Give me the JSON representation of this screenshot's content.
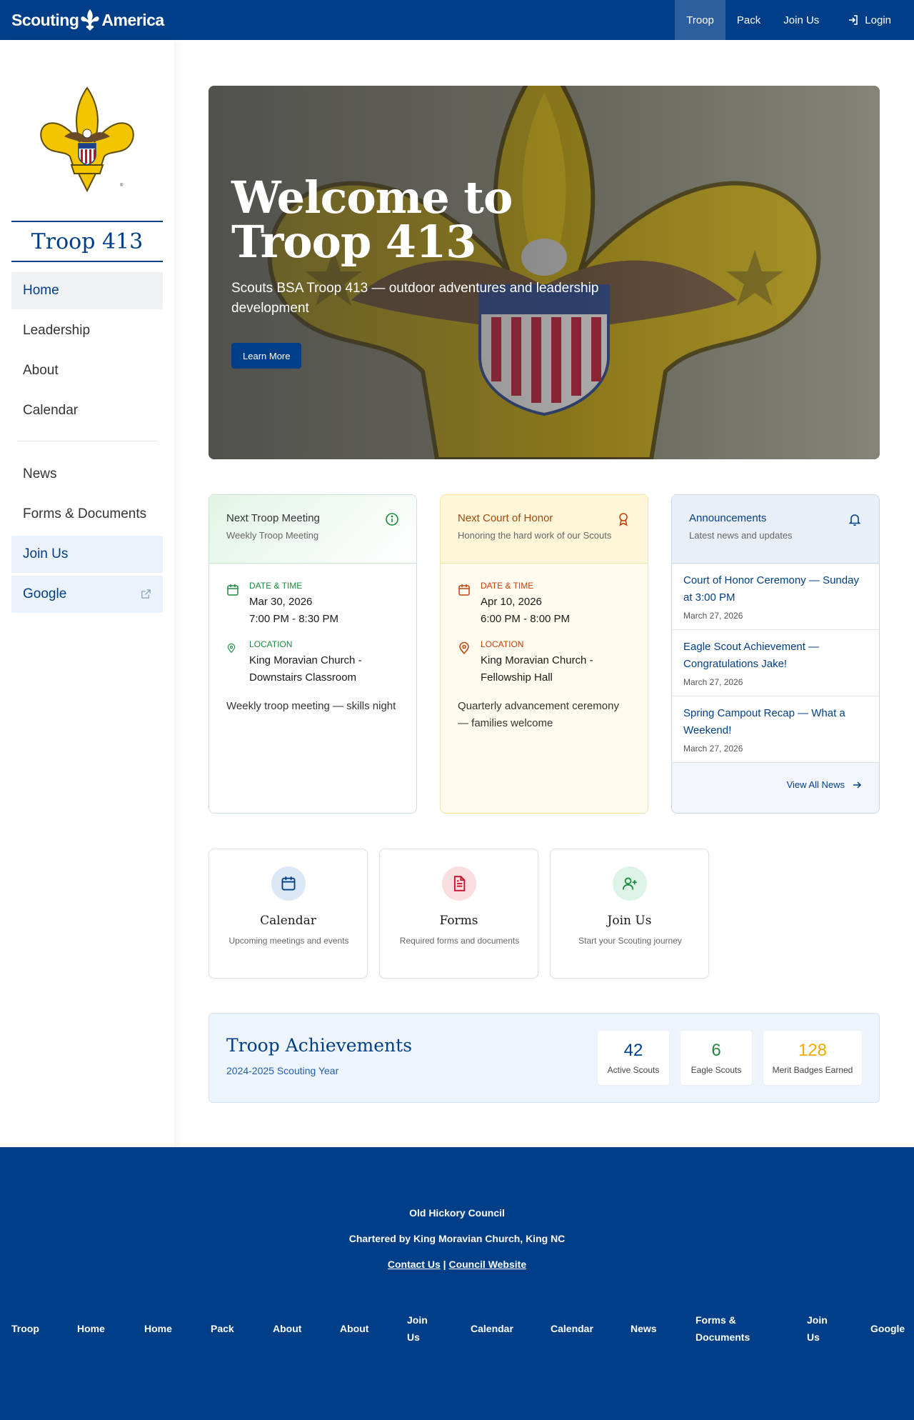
{
  "topnav": {
    "brand_left": "Scouting",
    "brand_right": "America",
    "links": [
      {
        "label": "Troop"
      },
      {
        "label": "Pack"
      },
      {
        "label": "Join Us"
      },
      {
        "label": "Login",
        "icon": "login-icon"
      }
    ]
  },
  "sidebar": {
    "title": "Troop 413",
    "items": [
      {
        "label": "Home"
      },
      {
        "label": "Leadership"
      },
      {
        "label": "About"
      },
      {
        "label": "Calendar"
      },
      {
        "label": "News"
      },
      {
        "label": "Forms & Documents"
      },
      {
        "label": "Join Us"
      },
      {
        "label": "Google",
        "icon": "external-link-icon"
      }
    ]
  },
  "hero": {
    "title": "Welcome to Troop 413",
    "subtitle": "Scouts BSA Troop 413 — outdoor adventures and leadership development",
    "button": "Learn More"
  },
  "meeting_card": {
    "title": "Next Troop Meeting",
    "subtitle": "Weekly Troop Meeting",
    "date_label": "DATE & TIME",
    "date": "Mar 30, 2026",
    "time": "7:00 PM - 8:30 PM",
    "location_label": "LOCATION",
    "location": "King Moravian Church - Downstairs Classroom",
    "description": "Weekly troop meeting — skills night"
  },
  "honor_card": {
    "title": "Next Court of Honor",
    "subtitle": "Honoring the hard work of our Scouts",
    "date_label": "DATE & TIME",
    "date": "Apr 10, 2026",
    "time": "6:00 PM - 8:00 PM",
    "location_label": "LOCATION",
    "location": "King Moravian Church - Fellowship Hall",
    "description": "Quarterly advancement ceremony — families welcome"
  },
  "announcements": {
    "title": "Announcements",
    "subtitle": "Latest news and updates",
    "items": [
      {
        "title": "Court of Honor Ceremony — Sunday at 3:00 PM",
        "date": "March 27, 2026"
      },
      {
        "title": "Eagle Scout Achievement — Congratulations Jake!",
        "date": "March 27, 2026"
      },
      {
        "title": "Spring Campout Recap — What a Weekend!",
        "date": "March 27, 2026"
      }
    ],
    "view_all": "View All News"
  },
  "quick_links": [
    {
      "title": "Calendar",
      "desc": "Upcoming meetings and events",
      "icon": "calendar-icon",
      "bg": "#DCE7F5",
      "fg": "#003F87"
    },
    {
      "title": "Forms",
      "desc": "Required forms and documents",
      "icon": "document-icon",
      "bg": "#FADDDF",
      "fg": "#C8102E"
    },
    {
      "title": "Join Us",
      "desc": "Start your Scouting journey",
      "icon": "user-plus-icon",
      "bg": "#DDF3E6",
      "fg": "#1E8A3E"
    }
  ],
  "achievements": {
    "title": "Troop Achievements",
    "subtitle": "2024-2025 Scouting Year",
    "stats": [
      {
        "value": "42",
        "label": "Active Scouts",
        "color": "#003F87"
      },
      {
        "value": "6",
        "label": "Eagle Scouts",
        "color": "#1E8A3E"
      },
      {
        "value": "128",
        "label": "Merit Badges Earned",
        "color": "#F2A900"
      }
    ]
  },
  "footer": {
    "council": "Old Hickory Council",
    "charter": "Chartered by King Moravian Church, King NC",
    "contact": "Contact Us",
    "separator": "|",
    "council_site": "Council Website",
    "nav": [
      "Troop",
      "Home",
      "Home",
      "Pack",
      "About",
      "About",
      "Join Us",
      "Calendar",
      "Calendar",
      "News",
      "Forms & Documents",
      "Join Us",
      "Google"
    ]
  },
  "colors": {
    "brand_blue": "#003F87",
    "scout_gold": "#F2C500",
    "scout_red": "#C8102E",
    "green": "#1E8A3E"
  }
}
